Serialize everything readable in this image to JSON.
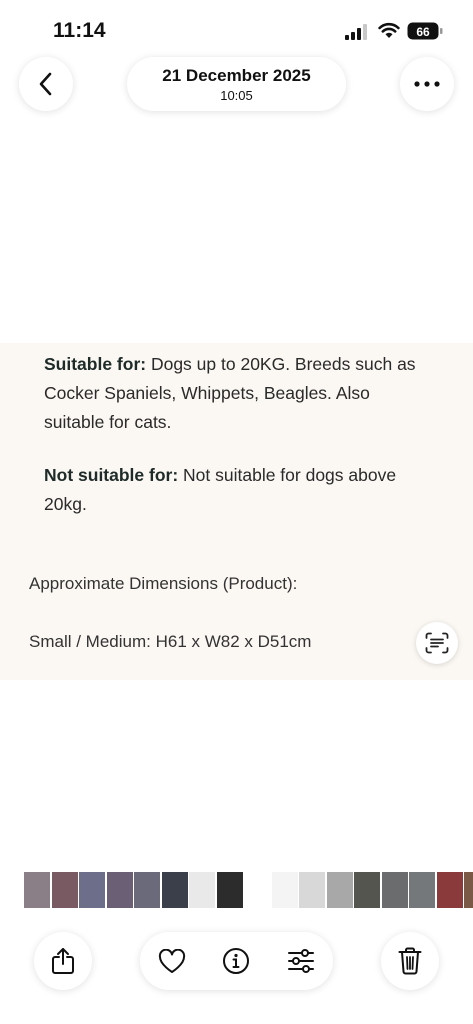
{
  "status_bar": {
    "time": "11:14",
    "battery": "66",
    "icons": [
      "cellular-signal-icon",
      "wifi-icon",
      "battery-icon"
    ]
  },
  "header": {
    "back_icon": "chevron-left-icon",
    "date": "21 December 2025",
    "time": "10:05",
    "more_icon": "ellipsis-icon"
  },
  "photo": {
    "suitable_label": "Suitable for:",
    "suitable_text": " Dogs up to 20KG. Breeds such as Cocker Spaniels, Whippets, Beagles. Also suitable for cats.",
    "not_suitable_label": "Not suitable for:",
    "not_suitable_text": " Not suitable for dogs above 20kg.",
    "dimensions_label": "Approximate Dimensions (Product):",
    "dimensions_value": "Small / Medium: H61 x W82 x D51cm",
    "live_text_icon": "live-text-icon",
    "background": "#fbf8f3"
  },
  "thumbnails": {
    "colors": [
      "#8a7f86",
      "#7a5a62",
      "#6d6f8a",
      "#6a5f74",
      "#6b6a7a",
      "#3b3f4a",
      "#e9e9e9",
      "#2d2c2c",
      "#ffffff",
      "#f4f4f4",
      "#d8d8d8",
      "#a8a8a8",
      "#55554f",
      "#6a6c6e",
      "#74787a",
      "#8a3a3a",
      "#7a5a46",
      "#9a3030",
      "#c9c9c9"
    ]
  },
  "toolbar": {
    "share_icon": "share-icon",
    "favorite_icon": "heart-icon",
    "info_icon": "info-icon",
    "adjust_icon": "sliders-icon",
    "delete_icon": "trash-icon"
  }
}
